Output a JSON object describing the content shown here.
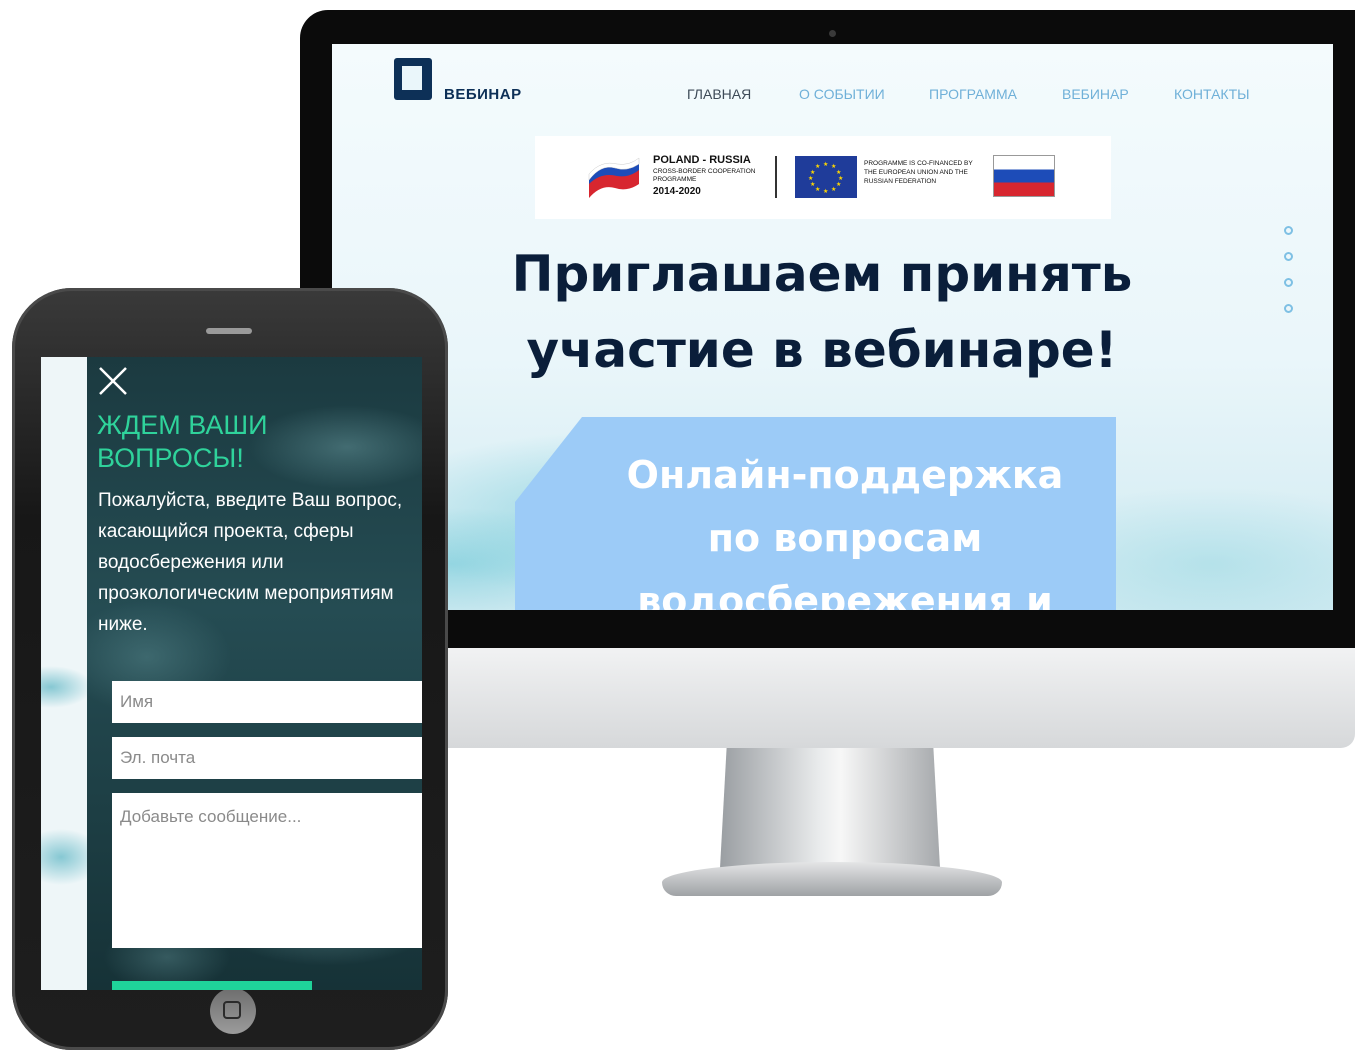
{
  "desktop": {
    "logo": {
      "text": "ВЕБИНАР"
    },
    "nav": [
      {
        "label": "ГЛАВНАЯ",
        "active": true
      },
      {
        "label": "О СОБЫТИИ",
        "active": false
      },
      {
        "label": "ПРОГРАММА",
        "active": false
      },
      {
        "label": "ВЕБИНАР",
        "active": false
      },
      {
        "label": "КОНТАКТЫ",
        "active": false
      }
    ],
    "partner_banner": {
      "programme_title": "POLAND - RUSSIA",
      "programme_subtitle": "CROSS-BORDER COOPERATION PROGRAMME",
      "programme_years": "2014-2020",
      "cofinanced_text": "PROGRAMME IS CO-FINANCED BY THE EUROPEAN UNION AND THE RUSSIAN FEDERATION"
    },
    "hero": {
      "line1": "Приглашаем принять",
      "line2": "участие в вебинаре!"
    },
    "support": {
      "line1": "Онлайн-поддержка",
      "line2": "по вопросам",
      "line3": "водосбережения и"
    },
    "slider_dots": 4
  },
  "mobile": {
    "modal": {
      "title_line1": "ЖДЕМ ВАШИ",
      "title_line2": "ВОПРОСЫ!",
      "description": "Пожалуйста, введите Ваш вопрос, касающийся проекта, сферы водосбережения или проэкологическим мероприятиям ниже.",
      "name_placeholder": "Имя",
      "email_placeholder": "Эл. почта",
      "message_placeholder": "Добавьте сообщение..."
    }
  },
  "colors": {
    "navy": "#0a1e3a",
    "nav_link": "#6fb0d8",
    "support_box": "#9ccbf7",
    "accent_green": "#2fd39b"
  }
}
